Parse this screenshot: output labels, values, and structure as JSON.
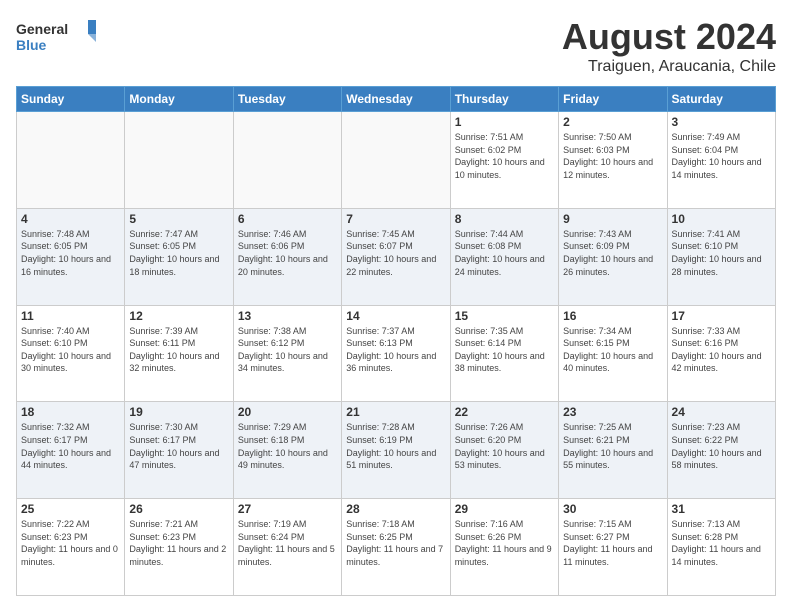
{
  "logo": {
    "general": "General",
    "blue": "Blue"
  },
  "title": "August 2024",
  "subtitle": "Traiguen, Araucania, Chile",
  "days_of_week": [
    "Sunday",
    "Monday",
    "Tuesday",
    "Wednesday",
    "Thursday",
    "Friday",
    "Saturday"
  ],
  "weeks": [
    [
      {
        "day": "",
        "info": ""
      },
      {
        "day": "",
        "info": ""
      },
      {
        "day": "",
        "info": ""
      },
      {
        "day": "",
        "info": ""
      },
      {
        "day": "1",
        "info": "Sunrise: 7:51 AM\nSunset: 6:02 PM\nDaylight: 10 hours and 10 minutes."
      },
      {
        "day": "2",
        "info": "Sunrise: 7:50 AM\nSunset: 6:03 PM\nDaylight: 10 hours and 12 minutes."
      },
      {
        "day": "3",
        "info": "Sunrise: 7:49 AM\nSunset: 6:04 PM\nDaylight: 10 hours and 14 minutes."
      }
    ],
    [
      {
        "day": "4",
        "info": "Sunrise: 7:48 AM\nSunset: 6:05 PM\nDaylight: 10 hours and 16 minutes."
      },
      {
        "day": "5",
        "info": "Sunrise: 7:47 AM\nSunset: 6:05 PM\nDaylight: 10 hours and 18 minutes."
      },
      {
        "day": "6",
        "info": "Sunrise: 7:46 AM\nSunset: 6:06 PM\nDaylight: 10 hours and 20 minutes."
      },
      {
        "day": "7",
        "info": "Sunrise: 7:45 AM\nSunset: 6:07 PM\nDaylight: 10 hours and 22 minutes."
      },
      {
        "day": "8",
        "info": "Sunrise: 7:44 AM\nSunset: 6:08 PM\nDaylight: 10 hours and 24 minutes."
      },
      {
        "day": "9",
        "info": "Sunrise: 7:43 AM\nSunset: 6:09 PM\nDaylight: 10 hours and 26 minutes."
      },
      {
        "day": "10",
        "info": "Sunrise: 7:41 AM\nSunset: 6:10 PM\nDaylight: 10 hours and 28 minutes."
      }
    ],
    [
      {
        "day": "11",
        "info": "Sunrise: 7:40 AM\nSunset: 6:10 PM\nDaylight: 10 hours and 30 minutes."
      },
      {
        "day": "12",
        "info": "Sunrise: 7:39 AM\nSunset: 6:11 PM\nDaylight: 10 hours and 32 minutes."
      },
      {
        "day": "13",
        "info": "Sunrise: 7:38 AM\nSunset: 6:12 PM\nDaylight: 10 hours and 34 minutes."
      },
      {
        "day": "14",
        "info": "Sunrise: 7:37 AM\nSunset: 6:13 PM\nDaylight: 10 hours and 36 minutes."
      },
      {
        "day": "15",
        "info": "Sunrise: 7:35 AM\nSunset: 6:14 PM\nDaylight: 10 hours and 38 minutes."
      },
      {
        "day": "16",
        "info": "Sunrise: 7:34 AM\nSunset: 6:15 PM\nDaylight: 10 hours and 40 minutes."
      },
      {
        "day": "17",
        "info": "Sunrise: 7:33 AM\nSunset: 6:16 PM\nDaylight: 10 hours and 42 minutes."
      }
    ],
    [
      {
        "day": "18",
        "info": "Sunrise: 7:32 AM\nSunset: 6:17 PM\nDaylight: 10 hours and 44 minutes."
      },
      {
        "day": "19",
        "info": "Sunrise: 7:30 AM\nSunset: 6:17 PM\nDaylight: 10 hours and 47 minutes."
      },
      {
        "day": "20",
        "info": "Sunrise: 7:29 AM\nSunset: 6:18 PM\nDaylight: 10 hours and 49 minutes."
      },
      {
        "day": "21",
        "info": "Sunrise: 7:28 AM\nSunset: 6:19 PM\nDaylight: 10 hours and 51 minutes."
      },
      {
        "day": "22",
        "info": "Sunrise: 7:26 AM\nSunset: 6:20 PM\nDaylight: 10 hours and 53 minutes."
      },
      {
        "day": "23",
        "info": "Sunrise: 7:25 AM\nSunset: 6:21 PM\nDaylight: 10 hours and 55 minutes."
      },
      {
        "day": "24",
        "info": "Sunrise: 7:23 AM\nSunset: 6:22 PM\nDaylight: 10 hours and 58 minutes."
      }
    ],
    [
      {
        "day": "25",
        "info": "Sunrise: 7:22 AM\nSunset: 6:23 PM\nDaylight: 11 hours and 0 minutes."
      },
      {
        "day": "26",
        "info": "Sunrise: 7:21 AM\nSunset: 6:23 PM\nDaylight: 11 hours and 2 minutes."
      },
      {
        "day": "27",
        "info": "Sunrise: 7:19 AM\nSunset: 6:24 PM\nDaylight: 11 hours and 5 minutes."
      },
      {
        "day": "28",
        "info": "Sunrise: 7:18 AM\nSunset: 6:25 PM\nDaylight: 11 hours and 7 minutes."
      },
      {
        "day": "29",
        "info": "Sunrise: 7:16 AM\nSunset: 6:26 PM\nDaylight: 11 hours and 9 minutes."
      },
      {
        "day": "30",
        "info": "Sunrise: 7:15 AM\nSunset: 6:27 PM\nDaylight: 11 hours and 11 minutes."
      },
      {
        "day": "31",
        "info": "Sunrise: 7:13 AM\nSunset: 6:28 PM\nDaylight: 11 hours and 14 minutes."
      }
    ]
  ]
}
